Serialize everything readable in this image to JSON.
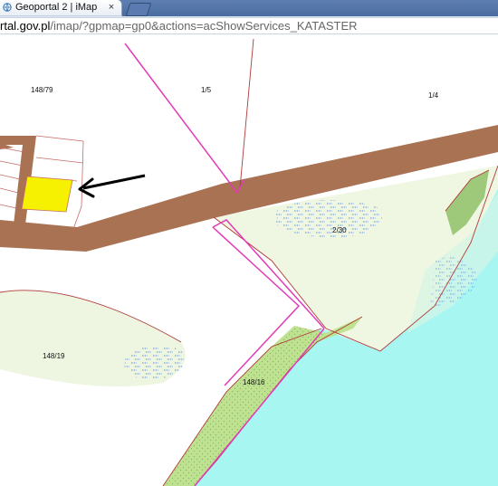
{
  "browser": {
    "tab_title": "Geoportal 2 | iMap",
    "close_glyph": "×",
    "url_domain": "rtal.gov.pl",
    "url_path": "/imap/?gpmap=gp0&actions=acShowServices_KATASTER"
  },
  "map": {
    "parcels": {
      "p148_79": "148/79",
      "p1_5": "1/5",
      "p1_4": "1/4",
      "p2_30": "2/30",
      "p148_19": "148/19",
      "p148_16": "148/16"
    },
    "colors": {
      "road": "#a87253",
      "highlight_parcel": "#f6f100",
      "water": "#a7f6f2",
      "meadow": "#eff7e2",
      "vegetation": "#bfe291",
      "boundary_red": "#b03a3a",
      "boundary_magenta": "#e23ab8",
      "arrow": "#000000",
      "marsh_symbol": "#5a8bd8"
    },
    "icons": {
      "arrow": "arrow-left-icon",
      "tab": "globe-icon",
      "close": "close-icon"
    }
  }
}
